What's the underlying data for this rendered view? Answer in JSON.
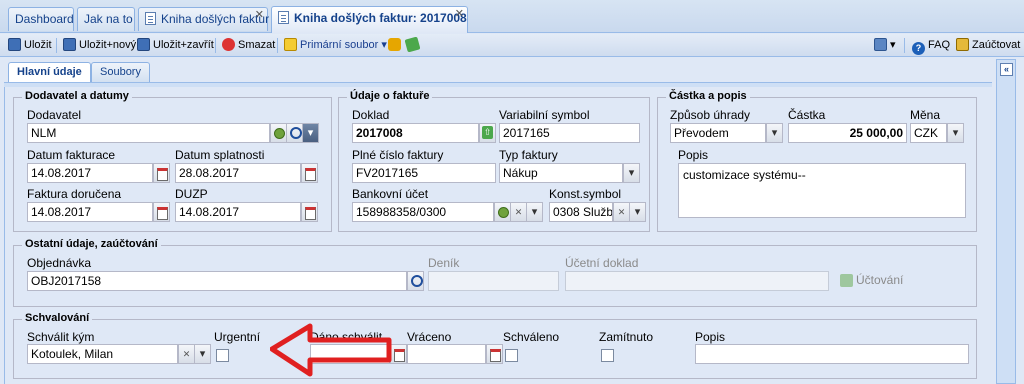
{
  "tabs": [
    {
      "label": "Dashboard"
    },
    {
      "label": "Jak na to"
    },
    {
      "label": "Kniha došlých faktur"
    },
    {
      "label": "Kniha došlých faktur: 2017008"
    }
  ],
  "toolbar": {
    "save": "Uložit",
    "save_new": "Uložit+nový",
    "save_close": "Uložit+zavřít",
    "delete": "Smazat",
    "primary_file": "Primární soubor",
    "faq": "FAQ",
    "post": "Zaúčtovat"
  },
  "content_tabs": [
    {
      "label": "Hlavní údaje"
    },
    {
      "label": "Soubory"
    }
  ],
  "supplier": {
    "legend": "Dodavatel a datumy",
    "supplier_label": "Dodavatel",
    "supplier_value": "NLM",
    "invoice_date_label": "Datum fakturace",
    "invoice_date": "14.08.2017",
    "due_date_label": "Datum splatnosti",
    "due_date": "28.08.2017",
    "received_label": "Faktura doručena",
    "received": "14.08.2017",
    "duzp_label": "DUZP",
    "duzp": "14.08.2017"
  },
  "invoice": {
    "legend": "Údaje o faktuře",
    "doc_label": "Doklad",
    "doc": "2017008",
    "vs_label": "Variabilní symbol",
    "vs": "2017165",
    "full_no_label": "Plné číslo faktury",
    "full_no": "FV2017165",
    "type_label": "Typ faktury",
    "type": "Nákup",
    "bank_label": "Bankovní účet",
    "bank": "158988358/0300",
    "ks_label": "Konst.symbol",
    "ks": "0308 Služb"
  },
  "amount": {
    "legend": "Částka a popis",
    "payment_label": "Způsob úhrady",
    "payment": "Převodem",
    "amount_label": "Částka",
    "amount": "25 000,00",
    "currency_label": "Měna",
    "currency": "CZK",
    "desc_label": "Popis",
    "desc": "customizace systému--"
  },
  "other": {
    "legend": "Ostatní údaje, zaúčtování",
    "order_label": "Objednávka",
    "order": "OBJ2017158",
    "journal_label": "Deník",
    "acc_doc_label": "Účetní doklad",
    "accounting": "Účtování"
  },
  "approval": {
    "legend": "Schvalování",
    "approver_label": "Schválit kým",
    "approver": "Kotoulek, Milan",
    "urgent_label": "Urgentní",
    "sent_label": "Dáno schválit",
    "returned_label": "Vráceno",
    "approved_label": "Schváleno",
    "rejected_label": "Zamítnuto",
    "note_label": "Popis"
  },
  "colors": {
    "annotation_arrow": "#e02020"
  }
}
